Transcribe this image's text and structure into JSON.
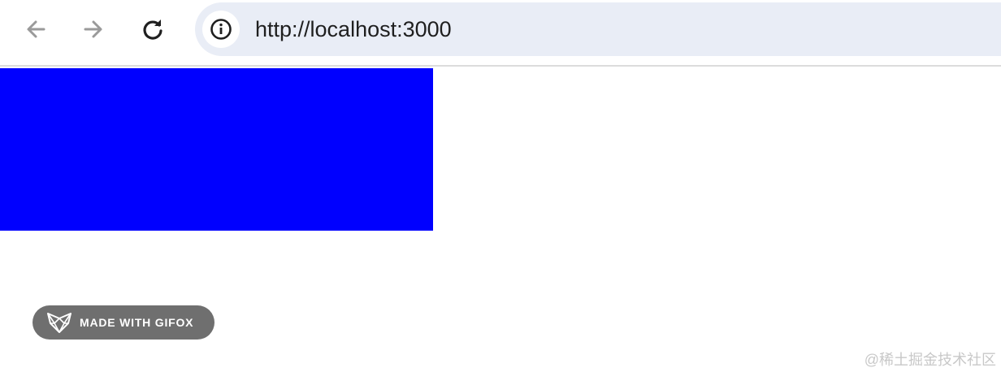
{
  "browser": {
    "url": "http://localhost:3000",
    "icons": {
      "back": "arrow-left-icon",
      "forward": "arrow-right-icon",
      "reload": "reload-icon",
      "site_info": "info-icon"
    }
  },
  "page": {
    "box_color": "#0000ff"
  },
  "badge": {
    "label": "MADE WITH GIFOX",
    "logo": "gifox-fox-icon"
  },
  "watermark": {
    "text": "@稀土掘金技术社区"
  }
}
